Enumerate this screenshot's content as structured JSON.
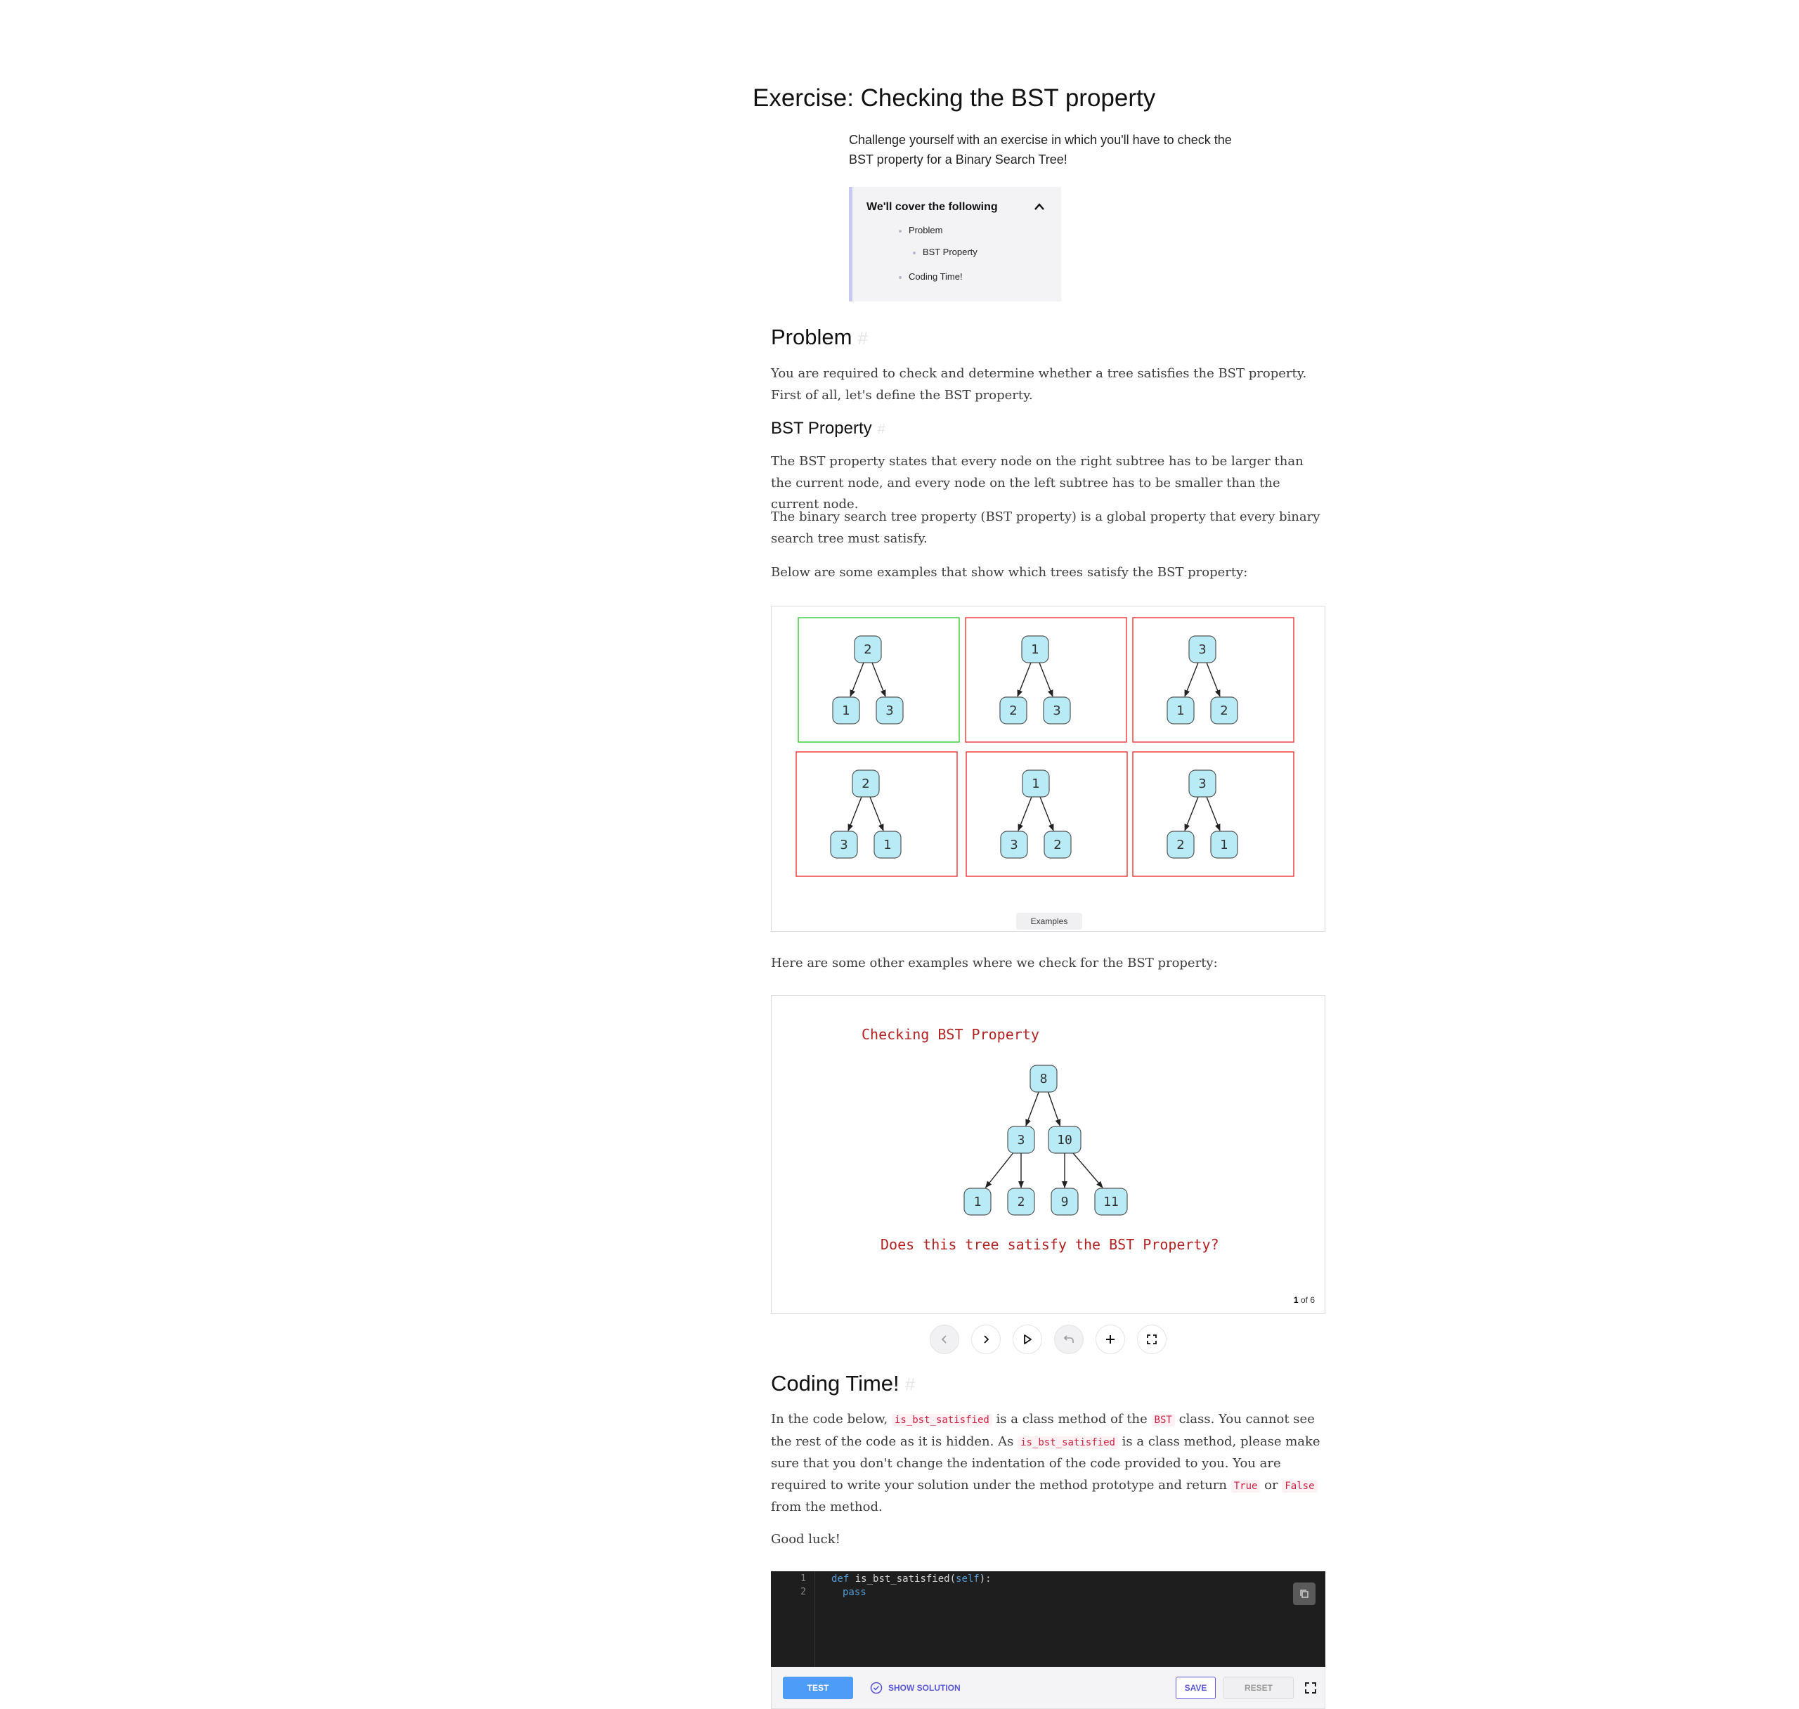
{
  "title": "Exercise: Checking the BST property",
  "intro": "Challenge yourself with an exercise in which you'll have to check the BST property for a Binary Search Tree!",
  "toc": {
    "heading": "We'll cover the following",
    "items": [
      "Problem",
      "BST Property",
      "Coding Time!"
    ]
  },
  "problem": {
    "heading": "Problem",
    "p1": "You are required to check and determine whether a tree satisfies the BST property. First of all, let's define the BST property."
  },
  "bst_property": {
    "heading": "BST Property",
    "p1": "The BST property states that every node on the right subtree has to be larger than the current node, and every node on the left subtree has to be smaller than the current node.",
    "p2": "The binary search tree property (BST property) is a global property that every binary search tree must satisfy.",
    "p3": "Below are some examples that show which trees satisfy the BST property:"
  },
  "examples_figure": {
    "caption": "Examples",
    "trees": [
      {
        "root": "2",
        "left": "1",
        "right": "3",
        "valid": true
      },
      {
        "root": "1",
        "left": "2",
        "right": "3",
        "valid": false
      },
      {
        "root": "3",
        "left": "1",
        "right": "2",
        "valid": false
      },
      {
        "root": "2",
        "left": "3",
        "right": "1",
        "valid": false
      },
      {
        "root": "1",
        "left": "3",
        "right": "2",
        "valid": false
      },
      {
        "root": "3",
        "left": "2",
        "right": "1",
        "valid": false
      }
    ]
  },
  "other_examples_text": "Here are some other examples where we check for the BST property:",
  "slides": {
    "title": "Checking BST Property",
    "question": "Does this tree satisfy the BST Property?",
    "nodes": {
      "root": "8",
      "l": "3",
      "r": "10",
      "ll": "1",
      "lr": "2",
      "rl": "9",
      "rr": "11"
    },
    "current": "1",
    "of": "of",
    "total": "6",
    "controls": [
      "prev-icon",
      "next-icon",
      "play-icon",
      "undo-icon",
      "plus-icon",
      "fullscreen-icon"
    ]
  },
  "coding_time": {
    "heading": "Coding Time!",
    "p1_a": "In the code below,",
    "code1": "is_bst_satisfied",
    "p1_b": "is a class method of the",
    "code2": "BST",
    "p1_c": "class. You cannot see the rest of the code as it is hidden. As",
    "code3": "is_bst_satisfied",
    "p1_d": "is a class method, please make sure that you don't change the indentation of the code provided to you. You are required to write your solution under the method prototype and return",
    "code4": "True",
    "p1_e": "or",
    "code5": "False",
    "p1_f": "from the method.",
    "p2": "Good luck!"
  },
  "editor": {
    "line1_no": "1",
    "line2_no": "2",
    "line1_kw": "def",
    "line1_rest": " is_bst_satisfied(",
    "line1_self": "self",
    "line1_end": "):",
    "line2_kw": "pass"
  },
  "toolbar": {
    "test": "TEST",
    "show_solution": "SHOW SOLUTION",
    "save": "SAVE",
    "reset": "RESET"
  },
  "colors": {
    "node_fill": "#b8ebf6",
    "node_stroke": "#555555",
    "valid_border": "#33cc33",
    "invalid_border": "#ee3333",
    "slide_text": "#b22222",
    "accent": "#5b59d6",
    "test_button": "#4d9cf8"
  }
}
